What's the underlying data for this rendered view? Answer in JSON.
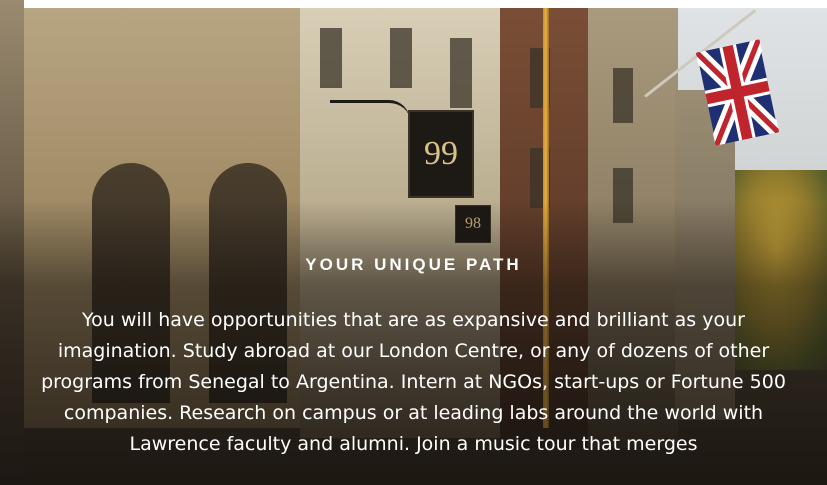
{
  "hero": {
    "sign_primary_number": "99",
    "sign_secondary_number": "98",
    "heading": "YOUR UNIQUE PATH",
    "body": "You will have opportunities that are as expansive and brilliant as your imagination. Study abroad at our London Centre, or any of dozens of other programs from Senegal to Argentina. Intern at NGOs, start-ups or Fortune 500 companies. Research on campus or at leading labs around the world with Lawrence faculty and alumni. Join a music tour that merges"
  },
  "colors": {
    "text": "#ffffff",
    "sign_background": "#1d1914",
    "sign_text": "#d9c28a"
  },
  "icons": [
    "union-jack-flag-icon"
  ]
}
